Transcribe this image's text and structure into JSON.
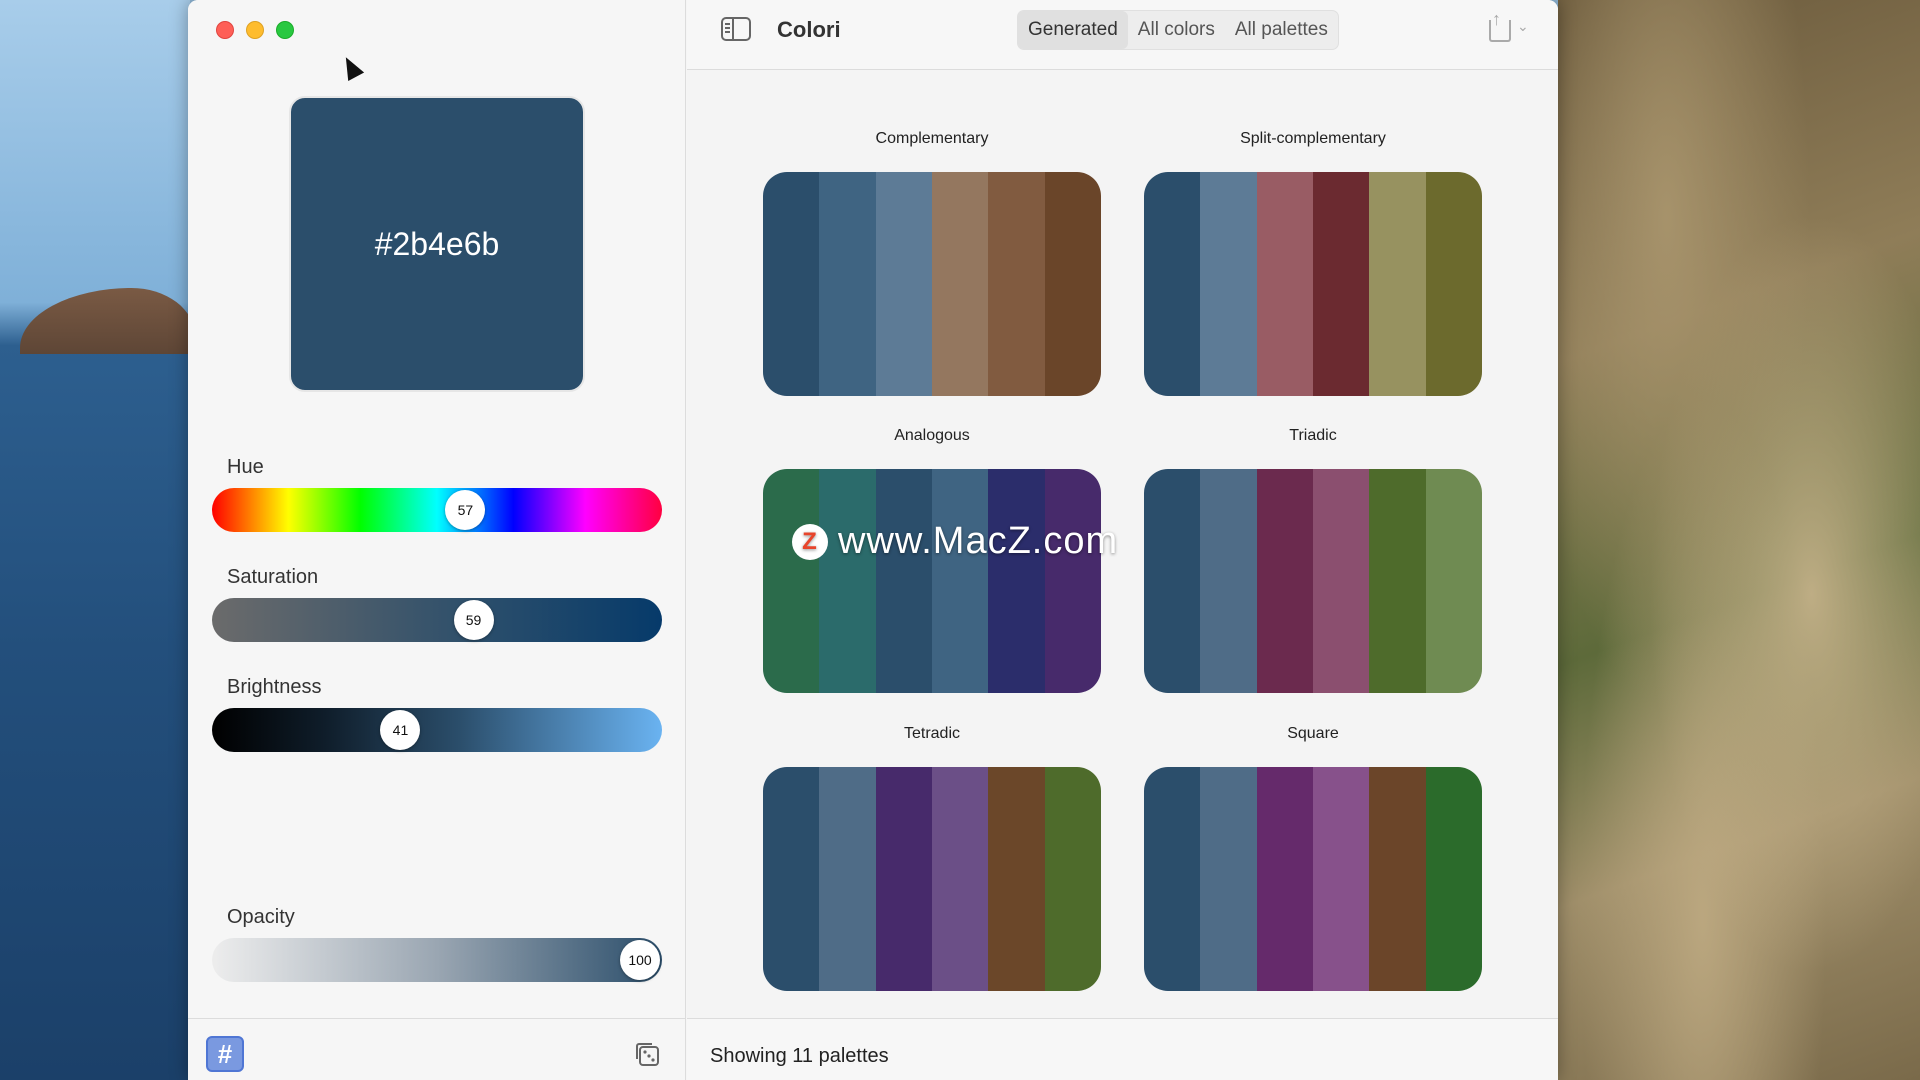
{
  "app": {
    "title": "Colori"
  },
  "toolbar": {
    "tabs": [
      {
        "label": "Generated",
        "active": true
      },
      {
        "label": "All colors",
        "active": false
      },
      {
        "label": "All palettes",
        "active": false
      }
    ]
  },
  "sidebar": {
    "color_hex": "#2b4e6b",
    "sliders": {
      "hue": {
        "label": "Hue",
        "value": "57",
        "fraction": 0.57
      },
      "saturation": {
        "label": "Saturation",
        "value": "59",
        "fraction": 0.59
      },
      "brightness": {
        "label": "Brightness",
        "value": "41",
        "fraction": 0.41
      },
      "opacity": {
        "label": "Opacity",
        "value": "100",
        "fraction": 1.0
      }
    },
    "footer": {
      "hash_icon": "#",
      "dice_icon": "dice-icon"
    }
  },
  "palettes": [
    {
      "name": "Complementary",
      "colors": [
        "#2b4e6b",
        "#3f6482",
        "#5d7b96",
        "#94775f",
        "#815b40",
        "#6a4529"
      ]
    },
    {
      "name": "Split-complementary",
      "colors": [
        "#2b4e6b",
        "#5d7b96",
        "#995c64",
        "#6b2a30",
        "#979260",
        "#6c6a2d"
      ]
    },
    {
      "name": "Analogous",
      "colors": [
        "#2b6b4b",
        "#2b6b6b",
        "#2b4e6b",
        "#3f6482",
        "#2b2d6b",
        "#472a6b"
      ]
    },
    {
      "name": "Triadic",
      "colors": [
        "#2b4e6b",
        "#4f6c87",
        "#6b2a4e",
        "#8b4f6f",
        "#4e6b2b",
        "#6f8b52"
      ]
    },
    {
      "name": "Tetradic",
      "colors": [
        "#2b4e6b",
        "#4f6c87",
        "#472a6b",
        "#6b4f87",
        "#6b4729",
        "#4e6b2b"
      ]
    },
    {
      "name": "Square",
      "colors": [
        "#2b4e6b",
        "#4f6c87",
        "#652a6b",
        "#87518b",
        "#6b4529",
        "#2b6b2b"
      ]
    }
  ],
  "footer": {
    "status": "Showing 11 palettes"
  },
  "watermark": {
    "logo": "Z",
    "text": "www.MacZ.com"
  }
}
